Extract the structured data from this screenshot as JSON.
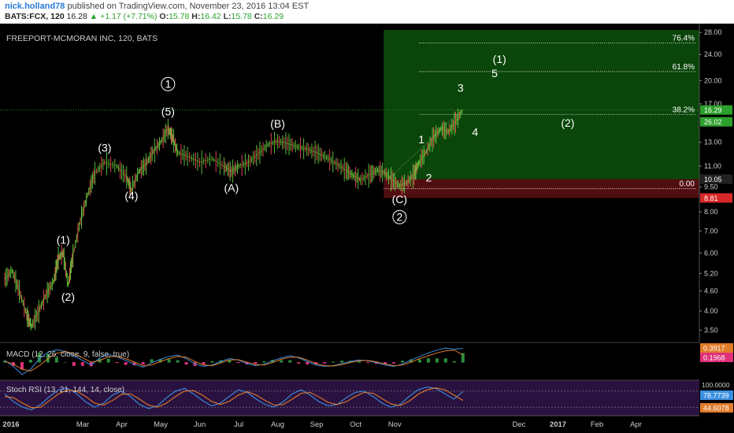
{
  "header": {
    "user": "nick.holland78",
    "published": "published on TradingView.com, November 23, 2016 13:04 EST",
    "symbol": "BATS:FCX, 120",
    "last": "16.28",
    "change": "▲ +1.17 (+7.71%)",
    "o_label": "O:",
    "o_val": "15.78",
    "h_label": "H:",
    "h_val": "16.42",
    "l_label": "L:",
    "l_val": "15.78",
    "c_label": "C:",
    "c_val": "16.29"
  },
  "chart_data": {
    "type": "line",
    "title": "FREEPORT-MCMORAN INC, 120, BATS",
    "y_scale": "log",
    "ylim": [
      3.3,
      28.5
    ],
    "y_ticks": [
      "28.00",
      "24.00",
      "20.00",
      "17.00",
      "13.00",
      "11.00",
      "9.50",
      "8.00",
      "7.00",
      "6.00",
      "5.20",
      "4.60",
      "4.00",
      "3.50"
    ],
    "x_ticks": [
      "2016",
      "Mar",
      "Apr",
      "May",
      "Jun",
      "Jul",
      "Aug",
      "Sep",
      "Oct",
      "Nov",
      "Dec",
      "2017",
      "Feb",
      "Apr"
    ],
    "series": [
      {
        "values": [
          [
            0,
            5.0
          ],
          [
            0.3,
            5.3
          ],
          [
            0.6,
            4.6
          ],
          [
            0.9,
            3.9
          ],
          [
            1.1,
            3.6
          ],
          [
            1.4,
            4.0
          ],
          [
            1.7,
            4.5
          ],
          [
            2.0,
            4.9
          ],
          [
            2.2,
            5.8
          ],
          [
            2.4,
            6.0
          ],
          [
            2.6,
            4.8
          ],
          [
            2.8,
            5.9
          ],
          [
            3.1,
            7.5
          ],
          [
            3.4,
            9.0
          ],
          [
            3.7,
            10.5
          ],
          [
            4.1,
            11.3
          ],
          [
            4.6,
            11.0
          ],
          [
            5.0,
            10.2
          ],
          [
            5.2,
            9.3
          ],
          [
            5.5,
            10.6
          ],
          [
            5.8,
            11.2
          ],
          [
            6.1,
            12.2
          ],
          [
            6.4,
            13.0
          ],
          [
            6.7,
            14.3
          ],
          [
            6.9,
            13.4
          ],
          [
            7.1,
            12.1
          ],
          [
            7.5,
            11.8
          ],
          [
            8.0,
            11.3
          ],
          [
            8.5,
            11.6
          ],
          [
            9.0,
            11.0
          ],
          [
            9.3,
            10.6
          ],
          [
            9.6,
            11.0
          ],
          [
            10.0,
            11.3
          ],
          [
            10.4,
            12.0
          ],
          [
            10.8,
            12.8
          ],
          [
            11.2,
            13.1
          ],
          [
            11.6,
            12.9
          ],
          [
            12.0,
            12.6
          ],
          [
            12.4,
            12.4
          ],
          [
            12.8,
            12.1
          ],
          [
            13.2,
            11.7
          ],
          [
            13.6,
            11.2
          ],
          [
            14.0,
            10.7
          ],
          [
            14.3,
            10.3
          ],
          [
            14.6,
            10.0
          ],
          [
            15.0,
            10.4
          ],
          [
            15.3,
            10.7
          ],
          [
            15.6,
            10.5
          ],
          [
            15.9,
            10.0
          ],
          [
            16.2,
            9.6
          ],
          [
            16.5,
            9.8
          ],
          [
            16.8,
            10.4
          ],
          [
            17.0,
            11.3
          ],
          [
            17.3,
            12.2
          ],
          [
            17.6,
            13.5
          ],
          [
            17.9,
            14.3
          ],
          [
            18.2,
            14.0
          ],
          [
            18.5,
            15.0
          ],
          [
            18.8,
            16.3
          ]
        ]
      }
    ],
    "x_tick_positions": [
      0,
      2.0,
      3.0,
      4.0,
      5.0,
      6.0,
      7.0,
      8.0,
      9.0,
      10.0,
      11.0,
      12.0,
      13.0,
      14.0
    ],
    "price_badges": [
      {
        "value": 16.29,
        "label": "16.29",
        "color": "#2ca02c"
      },
      {
        "value": 15.0,
        "label": "26.02",
        "color": "#2ca02c"
      },
      {
        "value": 10.05,
        "label": "10.05",
        "color": "#222222"
      },
      {
        "value": 8.81,
        "label": "8.81",
        "color": "#d62728"
      }
    ],
    "fib_levels": [
      {
        "label": "76.4%",
        "value": 26.0
      },
      {
        "label": "61.8%",
        "value": 21.3
      },
      {
        "label": "38.2%",
        "value": 15.8
      },
      {
        "label": "0.00",
        "value": 9.4
      }
    ],
    "zones": [
      {
        "name": "target",
        "from": 10.05,
        "to": 28.5,
        "color": "#0b4d0b"
      },
      {
        "name": "stop",
        "from": 8.81,
        "to": 10.05,
        "color": "#5a0f12"
      }
    ],
    "wave_labels": [
      {
        "text": "(1)",
        "x": 2.4,
        "y": 6.4
      },
      {
        "text": "(2)",
        "x": 2.6,
        "y": 4.3
      },
      {
        "text": "(3)",
        "x": 4.1,
        "y": 12.2
      },
      {
        "text": "(4)",
        "x": 5.2,
        "y": 8.7
      },
      {
        "text": "(5)",
        "x": 6.7,
        "y": 15.7
      },
      {
        "text": "1",
        "x": 6.7,
        "y": 19.0,
        "circled": true
      },
      {
        "text": "(A)",
        "x": 9.3,
        "y": 9.2
      },
      {
        "text": "(B)",
        "x": 11.2,
        "y": 14.4
      },
      {
        "text": "(C)",
        "x": 16.2,
        "y": 8.5
      },
      {
        "text": "2",
        "x": 16.2,
        "y": 7.5,
        "circled": true
      },
      {
        "text": "1",
        "x": 17.1,
        "y": 12.9
      },
      {
        "text": "2",
        "x": 17.4,
        "y": 9.9
      },
      {
        "text": "3",
        "x": 18.7,
        "y": 18.5
      },
      {
        "text": "4",
        "x": 19.3,
        "y": 13.6
      },
      {
        "text": "(1)",
        "x": 20.3,
        "y": 22.6
      },
      {
        "text": "5",
        "x": 20.1,
        "y": 20.5
      },
      {
        "text": "(2)",
        "x": 23.1,
        "y": 14.5
      }
    ],
    "x_max": 28.5
  },
  "macd": {
    "label": "MACD (12, 26, close, 9, false, true)",
    "v1": "0.3917",
    "v2": "0.1968",
    "values": [
      0.05,
      -0.12,
      -0.35,
      -0.2,
      0.1,
      0.28,
      0.35,
      0.3,
      0.18,
      0.05,
      -0.08,
      0.12,
      0.22,
      0.15,
      0.05,
      -0.06,
      -0.14,
      -0.02,
      0.08,
      0.16,
      0.2,
      0.1,
      -0.05,
      -0.12,
      -0.08,
      0.02,
      0.1,
      0.06,
      -0.04,
      -0.1,
      -0.06,
      0.04,
      0.12,
      0.18,
      0.12,
      0.02,
      -0.08,
      -0.12,
      -0.1,
      -0.04,
      0.02,
      0.06,
      0.04,
      -0.02,
      -0.08,
      -0.12,
      -0.05,
      0.06,
      0.16,
      0.26,
      0.34,
      0.4,
      0.36,
      0.39
    ],
    "signal": [
      0.02,
      -0.05,
      -0.2,
      -0.25,
      -0.1,
      0.1,
      0.25,
      0.3,
      0.25,
      0.12,
      0.0,
      0.05,
      0.15,
      0.16,
      0.1,
      0.0,
      -0.1,
      -0.08,
      0.02,
      0.1,
      0.16,
      0.14,
      0.02,
      -0.08,
      -0.1,
      -0.02,
      0.06,
      0.07,
      0.0,
      -0.07,
      -0.08,
      -0.01,
      0.08,
      0.14,
      0.14,
      0.06,
      -0.04,
      -0.1,
      -0.11,
      -0.07,
      -0.01,
      0.04,
      0.05,
      0.01,
      -0.05,
      -0.1,
      -0.08,
      0.0,
      0.1,
      0.18,
      0.26,
      0.32,
      0.34,
      0.2
    ]
  },
  "stoch": {
    "label": "Stoch RSI (13, 21, 144, 14, close)",
    "upper_label": "100.0000",
    "k_label": "78.7739",
    "d_label": "44.6078",
    "k": [
      70,
      40,
      20,
      10,
      30,
      60,
      85,
      90,
      70,
      40,
      20,
      35,
      65,
      80,
      60,
      30,
      15,
      25,
      55,
      80,
      90,
      70,
      45,
      25,
      35,
      60,
      85,
      75,
      50,
      30,
      20,
      40,
      70,
      85,
      65,
      40,
      25,
      30,
      55,
      75,
      80,
      60,
      35,
      20,
      30,
      60,
      85,
      95,
      90,
      70,
      50,
      78
    ],
    "d": [
      60,
      55,
      35,
      18,
      20,
      45,
      70,
      85,
      80,
      60,
      35,
      28,
      45,
      68,
      70,
      50,
      28,
      20,
      35,
      60,
      80,
      82,
      65,
      42,
      30,
      42,
      65,
      78,
      65,
      45,
      28,
      30,
      50,
      72,
      75,
      58,
      38,
      30,
      40,
      60,
      75,
      72,
      52,
      32,
      26,
      42,
      68,
      85,
      92,
      85,
      65,
      45
    ]
  }
}
